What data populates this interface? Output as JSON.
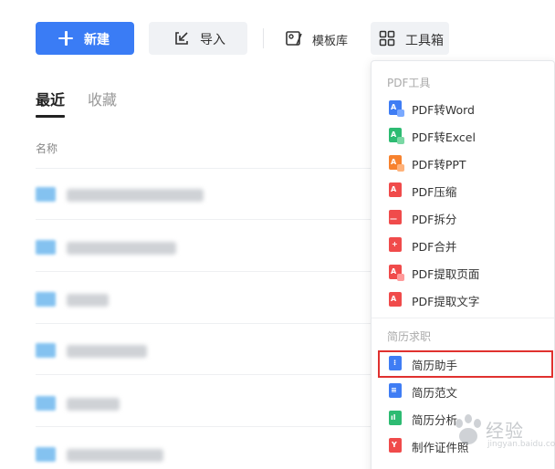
{
  "toolbar": {
    "new_label": "新建",
    "import_label": "导入",
    "templates_label": "模板库",
    "toolbox_label": "工具箱"
  },
  "tabs": {
    "recent": "最近",
    "favorites": "收藏"
  },
  "file_list": {
    "column_name": "名称",
    "rows_visible": 6
  },
  "toolbox_menu": {
    "pdf_group_title": "PDF工具",
    "pdf_items": [
      {
        "label": "PDF转Word",
        "icon": "pdf-to-word-icon",
        "color": "#3f7df4"
      },
      {
        "label": "PDF转Excel",
        "icon": "pdf-to-excel-icon",
        "color": "#2dbb72"
      },
      {
        "label": "PDF转PPT",
        "icon": "pdf-to-ppt-icon",
        "color": "#f7822e"
      },
      {
        "label": "PDF压缩",
        "icon": "pdf-compress-icon",
        "color": "#f04b4b"
      },
      {
        "label": "PDF拆分",
        "icon": "pdf-split-icon",
        "color": "#f04b4b"
      },
      {
        "label": "PDF合并",
        "icon": "pdf-merge-icon",
        "color": "#f04b4b"
      },
      {
        "label": "PDF提取页面",
        "icon": "pdf-extract-pages-icon",
        "color": "#f04b4b"
      },
      {
        "label": "PDF提取文字",
        "icon": "pdf-extract-text-icon",
        "color": "#f04b4b"
      }
    ],
    "resume_group_title": "简历求职",
    "resume_items": [
      {
        "label": "简历助手",
        "icon": "resume-assistant-icon",
        "color": "#3f7df4"
      },
      {
        "label": "简历范文",
        "icon": "resume-samples-icon",
        "color": "#3f7df4"
      },
      {
        "label": "简历分析",
        "icon": "resume-analysis-icon",
        "color": "#2dbb72"
      },
      {
        "label": "制作证件照",
        "icon": "id-photo-icon",
        "color": "#f04b4b"
      }
    ]
  },
  "watermark": {
    "text": "经验",
    "url": "jingyan.baidu.com"
  },
  "colors": {
    "primary": "#3a7cf5",
    "highlight_box": "#e0312f"
  }
}
